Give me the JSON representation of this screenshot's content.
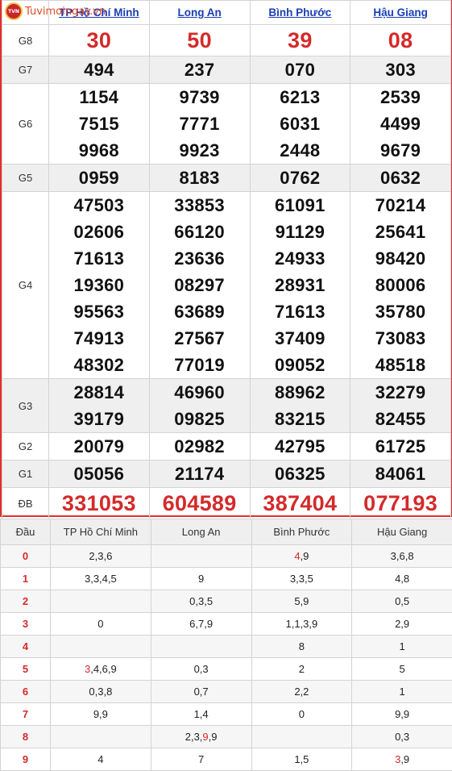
{
  "logo": {
    "badge_text": "TVN",
    "brand": "Tuvimoingay.vn"
  },
  "provinces": [
    "TP Hồ Chí Minh",
    "Long An",
    "Bình Phước",
    "Hậu Giang"
  ],
  "prizes": [
    {
      "label": "G8",
      "values": [
        [
          "30"
        ],
        [
          "50"
        ],
        [
          "39"
        ],
        [
          "08"
        ]
      ],
      "style": "red-big",
      "alt": false
    },
    {
      "label": "G7",
      "values": [
        [
          "494"
        ],
        [
          "237"
        ],
        [
          "070"
        ],
        [
          "303"
        ]
      ],
      "style": "normal",
      "alt": true
    },
    {
      "label": "G6",
      "values": [
        [
          "1154",
          "7515",
          "9968"
        ],
        [
          "9739",
          "7771",
          "9923"
        ],
        [
          "6213",
          "6031",
          "2448"
        ],
        [
          "2539",
          "4499",
          "9679"
        ]
      ],
      "style": "normal",
      "alt": false
    },
    {
      "label": "G5",
      "values": [
        [
          "0959"
        ],
        [
          "8183"
        ],
        [
          "0762"
        ],
        [
          "0632"
        ]
      ],
      "style": "normal",
      "alt": true
    },
    {
      "label": "G4",
      "values": [
        [
          "47503",
          "02606",
          "71613",
          "19360",
          "95563",
          "74913",
          "48302"
        ],
        [
          "33853",
          "66120",
          "23636",
          "08297",
          "63689",
          "27567",
          "77019"
        ],
        [
          "61091",
          "91129",
          "24933",
          "28931",
          "71613",
          "37409",
          "09052"
        ],
        [
          "70214",
          "25641",
          "98420",
          "80006",
          "35780",
          "73083",
          "48518"
        ]
      ],
      "style": "normal",
      "alt": false
    },
    {
      "label": "G3",
      "values": [
        [
          "28814",
          "39179"
        ],
        [
          "46960",
          "09825"
        ],
        [
          "88962",
          "83215"
        ],
        [
          "32279",
          "82455"
        ]
      ],
      "style": "normal",
      "alt": true
    },
    {
      "label": "G2",
      "values": [
        [
          "20079"
        ],
        [
          "02982"
        ],
        [
          "42795"
        ],
        [
          "61725"
        ]
      ],
      "style": "normal",
      "alt": false
    },
    {
      "label": "G1",
      "values": [
        [
          "05056"
        ],
        [
          "21174"
        ],
        [
          "06325"
        ],
        [
          "84061"
        ]
      ],
      "style": "normal",
      "alt": true
    },
    {
      "label": "ĐB",
      "values": [
        [
          "331053"
        ],
        [
          "604589"
        ],
        [
          "387404"
        ],
        [
          "077193"
        ]
      ],
      "style": "red-big",
      "alt": false
    }
  ],
  "loto": {
    "head_label": "Đầu",
    "columns": [
      "TP Hồ Chí Minh",
      "Long An",
      "Bình Phước",
      "Hậu Giang"
    ],
    "rows": [
      {
        "dau": "0",
        "cells": [
          [
            [
              "2,3,6",
              false
            ]
          ],
          [],
          [
            [
              "4",
              true
            ],
            [
              ",9",
              false
            ]
          ],
          [
            [
              "3,6,8",
              false
            ]
          ]
        ]
      },
      {
        "dau": "1",
        "cells": [
          [
            [
              "3,3,4,5",
              false
            ]
          ],
          [
            [
              "9",
              false
            ]
          ],
          [
            [
              "3,3,5",
              false
            ]
          ],
          [
            [
              "4,8",
              false
            ]
          ]
        ]
      },
      {
        "dau": "2",
        "cells": [
          [],
          [
            [
              "0,3,5",
              false
            ]
          ],
          [
            [
              "5,9",
              false
            ]
          ],
          [
            [
              "0,5",
              false
            ]
          ]
        ]
      },
      {
        "dau": "3",
        "cells": [
          [
            [
              "0",
              false
            ]
          ],
          [
            [
              "6,7,9",
              false
            ]
          ],
          [
            [
              "1,1,3,9",
              false
            ]
          ],
          [
            [
              "2,9",
              false
            ]
          ]
        ]
      },
      {
        "dau": "4",
        "cells": [
          [],
          [],
          [
            [
              "8",
              false
            ]
          ],
          [
            [
              "1",
              false
            ]
          ]
        ]
      },
      {
        "dau": "5",
        "cells": [
          [
            [
              "3",
              true
            ],
            [
              ",4,6,9",
              false
            ]
          ],
          [
            [
              "0,3",
              false
            ]
          ],
          [
            [
              "2",
              false
            ]
          ],
          [
            [
              "5",
              false
            ]
          ]
        ]
      },
      {
        "dau": "6",
        "cells": [
          [
            [
              "0,3,8",
              false
            ]
          ],
          [
            [
              "0,7",
              false
            ]
          ],
          [
            [
              "2,2",
              false
            ]
          ],
          [
            [
              "1",
              false
            ]
          ]
        ]
      },
      {
        "dau": "7",
        "cells": [
          [
            [
              "9,9",
              false
            ]
          ],
          [
            [
              "1,4",
              false
            ]
          ],
          [
            [
              "0",
              false
            ]
          ],
          [
            [
              "9,9",
              false
            ]
          ]
        ]
      },
      {
        "dau": "8",
        "cells": [
          [],
          [
            [
              "2,3,",
              false
            ],
            [
              "9",
              true
            ],
            [
              ",9",
              false
            ]
          ],
          [],
          [
            [
              "0,3",
              false
            ]
          ]
        ]
      },
      {
        "dau": "9",
        "cells": [
          [
            [
              "4",
              false
            ]
          ],
          [
            [
              "7",
              false
            ]
          ],
          [
            [
              "1,5",
              false
            ]
          ],
          [
            [
              "3",
              true
            ],
            [
              ",9",
              false
            ]
          ]
        ]
      }
    ]
  },
  "colors": {
    "accent_red": "#d42a2a",
    "link_blue": "#1a3fb5",
    "border_red": "#e0302a"
  }
}
